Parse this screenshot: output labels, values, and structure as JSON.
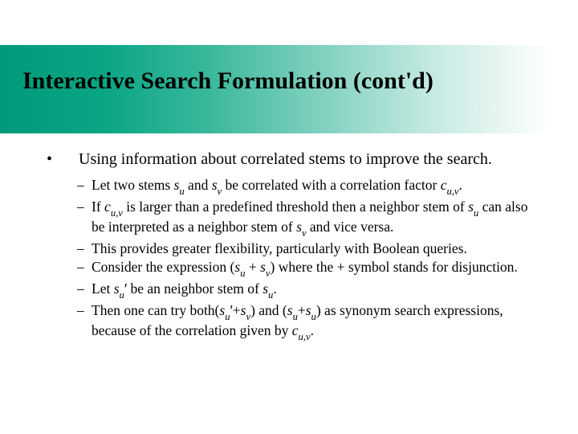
{
  "title": "Interactive Search Formulation (cont'd)",
  "point": {
    "bullet": "•",
    "text": "Using  information about correlated stems to improve the search."
  },
  "sub": {
    "dash": "–",
    "a": {
      "t1": "Let two stems ",
      "su": "s",
      "su_sub": "u",
      "t2": " and ",
      "sv": "s",
      "sv_sub": "v",
      "t3": " be correlated with a correlation factor ",
      "cuv": "c",
      "cuv_sub": "u,v",
      "t4": "."
    },
    "b": {
      "t1": "If ",
      "cuv": "c",
      "cuv_sub": "u,v",
      "t2": " is larger than a predefined threshold then a neighbor stem of ",
      "su": "s",
      "su_sub": "u",
      "t3": " can also be interpreted as a neighbor stem of ",
      "sv": "s",
      "sv_sub": "v",
      "t4": " and vice versa."
    },
    "c": "This provides greater flexibility, particularly with Boolean queries.",
    "d": {
      "t1": "Consider the expression (",
      "su": "s",
      "su_sub": "u",
      "t2": " + ",
      "sv": "s",
      "sv_sub": "v",
      "t3": ") where the + symbol stands for disjunction."
    },
    "e": {
      "t1": "Let ",
      "su": "s",
      "su_sub": "u",
      "prime": "′",
      "t2": " be an neighbor stem of ",
      "su2": "s",
      "su2_sub": "u",
      "t3": "."
    },
    "f": {
      "t1": "Then one can try both(",
      "su": "s",
      "su_sub": "u",
      "prime": "′",
      "t2": "+",
      "sv": "s",
      "sv_sub": "v",
      "t3": ") and (",
      "su2": "s",
      "su2_sub": "u",
      "t4": "+",
      "su3": "s",
      "su3_sub": "u",
      "t5": ") as synonym search expressions, because of the correlation given by ",
      "cuv": "c",
      "cuv_sub": "u,v",
      "t6": "."
    }
  }
}
